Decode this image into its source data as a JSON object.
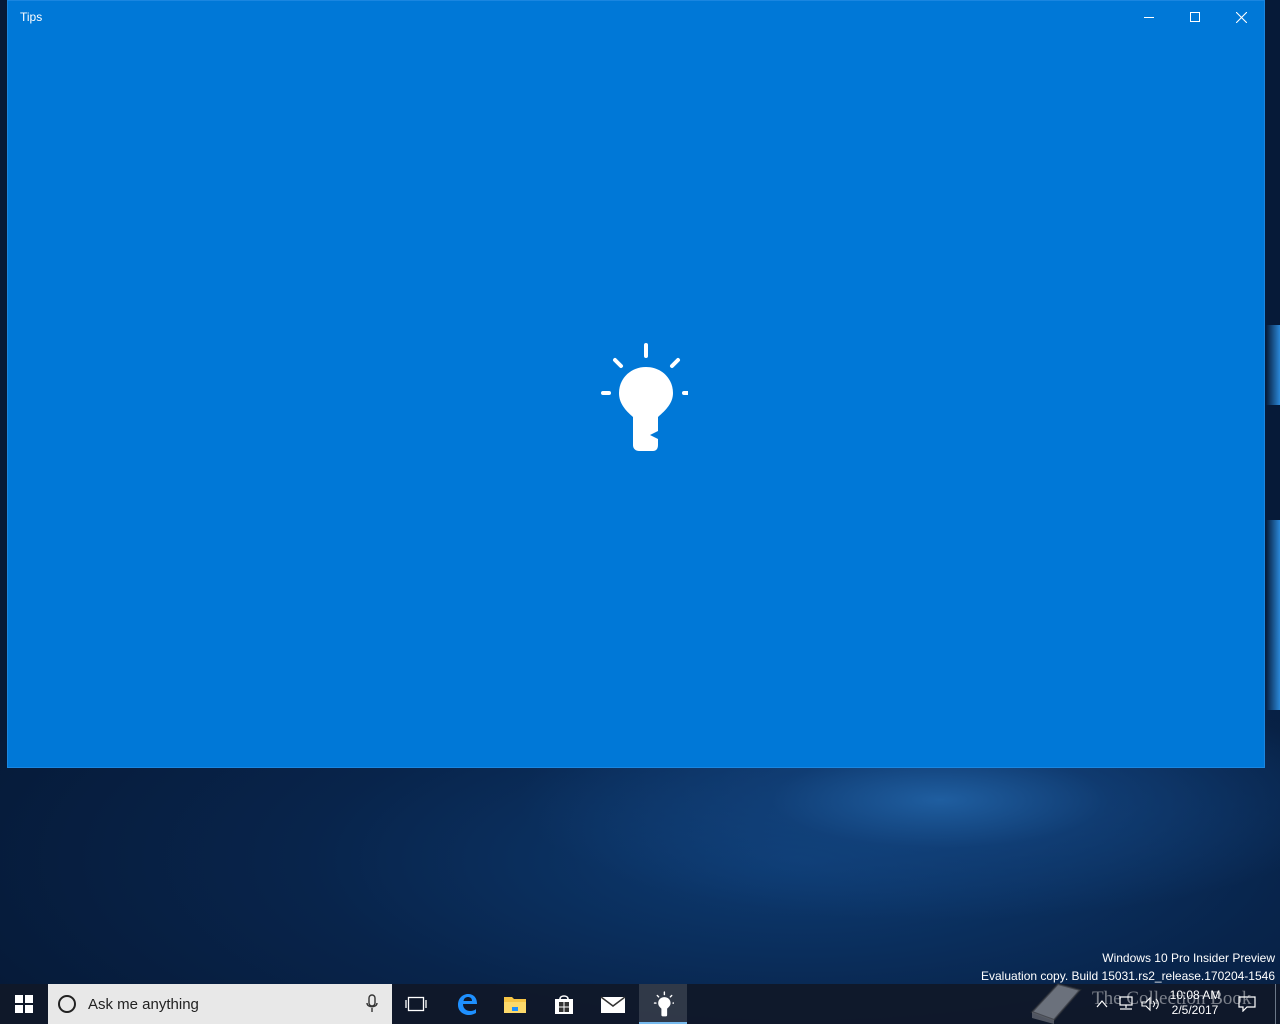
{
  "window": {
    "title": "Tips"
  },
  "desktop": {
    "watermark_line1": "Windows 10 Pro Insider Preview",
    "watermark_line2": "Evaluation copy. Build 15031.rs2_release.170204-1546"
  },
  "taskbar": {
    "search_placeholder": "Ask me anything",
    "pinned": [
      "task-view",
      "edge",
      "file-explorer",
      "store",
      "mail",
      "tips"
    ],
    "active_app": "tips"
  },
  "tray": {
    "time": "10:08 AM",
    "date": "2/5/2017"
  },
  "overlay": {
    "logo_text": "The Collection Book"
  },
  "colors": {
    "app_accent": "#0078d7",
    "taskbar": "#101828"
  }
}
